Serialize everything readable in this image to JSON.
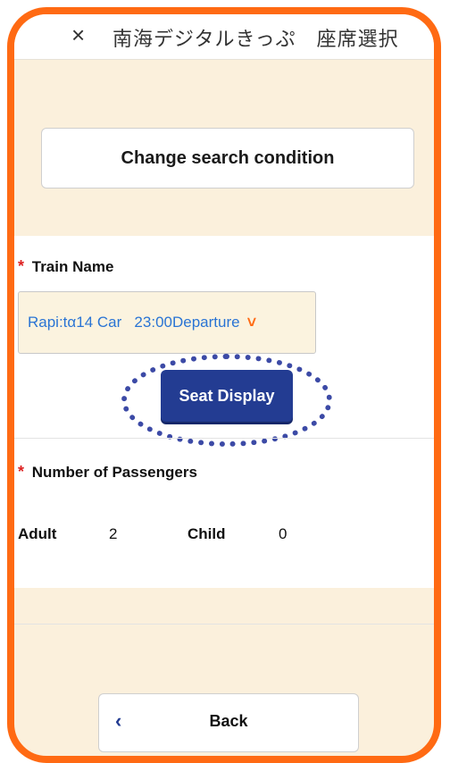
{
  "header": {
    "close_icon": "×",
    "title": "南海デジタルきっぷ　座席選択"
  },
  "search": {
    "change_label": "Change search condition"
  },
  "train": {
    "required_mark": "*",
    "label": "Train Name",
    "selected_value": "Rapi:tα14 Car   23:00Departure",
    "chevron": "˅"
  },
  "seat_display": {
    "label": "Seat Display"
  },
  "passengers": {
    "required_mark": "*",
    "label": "Number of Passengers",
    "adult_label": "Adult",
    "adult_value": "2",
    "child_label": "Child",
    "child_value": "0"
  },
  "back": {
    "chevron": "‹",
    "label": "Back"
  },
  "colors": {
    "accent_border": "#ff6a13",
    "primary_button": "#233c92",
    "page_band": "#fbf0dc",
    "link_text": "#2a74d4",
    "required": "#dd2222"
  }
}
